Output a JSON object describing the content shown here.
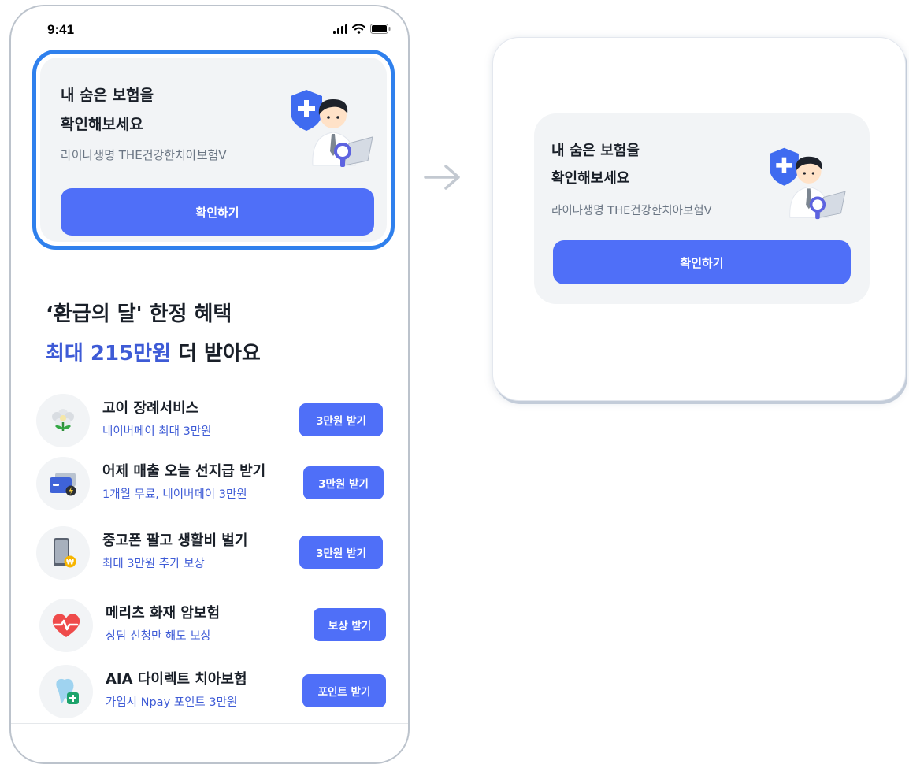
{
  "status_bar": {
    "time": "9:41",
    "icons": [
      "signal-icon",
      "wifi-icon",
      "battery-icon"
    ]
  },
  "insurance_card": {
    "title": "내 숨은 보험을\n확인해보세요",
    "subtitle": "라이나생명 THE건강한치아보험V",
    "button_label": "확인하기",
    "highlight_color": "#2f80ed"
  },
  "promo": {
    "line1": "‘환급의 달' 한정 혜택",
    "line2_highlight": "최대 215만원",
    "line2_rest": " 더 받아요"
  },
  "benefits": [
    {
      "icon": "flower-icon",
      "title": "고이 장례서비스",
      "subtitle": "네이버페이 최대 3만원",
      "button": "3만원 받기"
    },
    {
      "icon": "card-icon",
      "title": "어제 매출 오늘 선지급 받기",
      "subtitle": "1개월 무료, 네이버페이 3만원",
      "button": "3만원 받기"
    },
    {
      "icon": "phone-won-icon",
      "title": "중고폰 팔고 생활비 벌기",
      "subtitle": "최대 3만원 추가 보상",
      "button": "3만원 받기"
    },
    {
      "icon": "heart-pulse-icon",
      "title": "메리츠 화재 암보험",
      "subtitle": "상담 신청만 해도 보상",
      "button": "보상 받기"
    },
    {
      "icon": "tooth-icon",
      "title": "AIA 다이렉트 치아보험",
      "subtitle": "가입시 Npay 포인트 3만원",
      "button": "포인트 받기"
    }
  ],
  "colors": {
    "accent": "#4f6ff8",
    "highlight_text": "#3e5bd6",
    "card_bg": "#f2f4f6"
  }
}
